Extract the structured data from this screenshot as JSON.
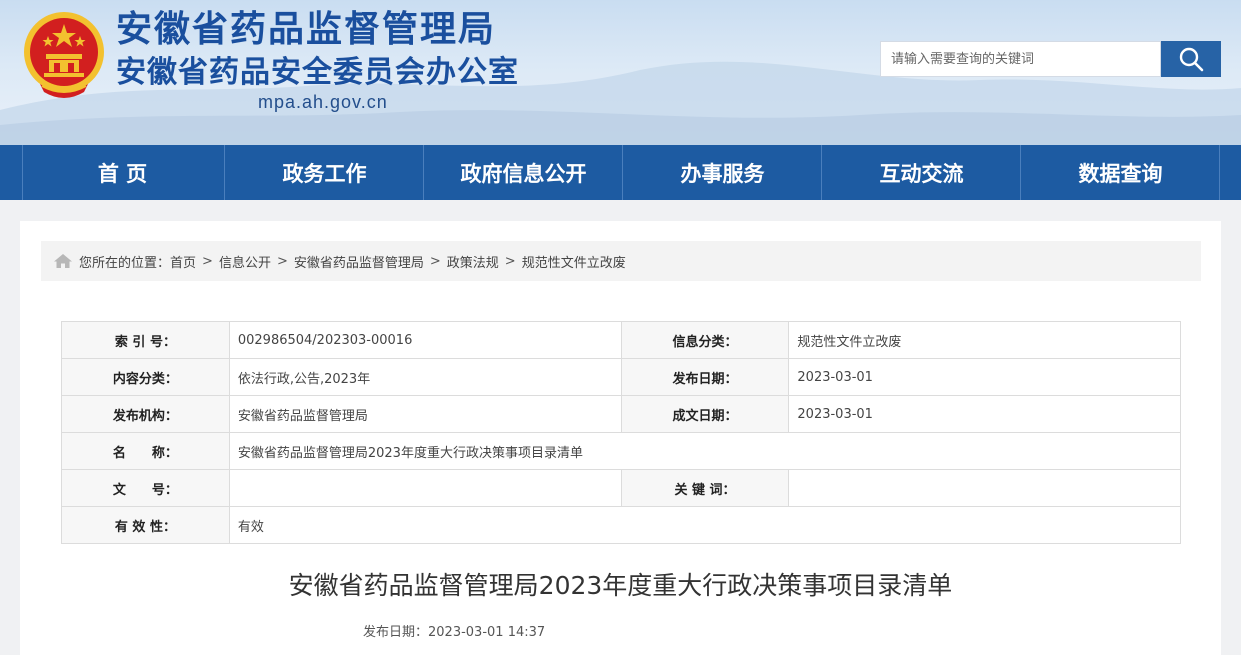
{
  "header": {
    "title": "安徽省药品监督管理局",
    "subtitle": "安徽省药品安全委员会办公室",
    "domain": "mpa.ah.gov.cn",
    "search_placeholder": "请输入需要查询的关键词",
    "emblem_icon": "national-emblem-icon",
    "search_icon": "magnifier-icon"
  },
  "nav": {
    "items": [
      {
        "label": "首 页"
      },
      {
        "label": "政务工作"
      },
      {
        "label": "政府信息公开"
      },
      {
        "label": "办事服务"
      },
      {
        "label": "互动交流"
      },
      {
        "label": "数据查询"
      }
    ]
  },
  "breadcrumb": {
    "prefix": "您所在的位置：",
    "items": [
      "首页",
      "信息公开",
      "安徽省药品监督管理局",
      "政策法规",
      "规范性文件立改废"
    ],
    "separator": ">"
  },
  "meta": {
    "index_label": "索 引 号：",
    "index_value": "002986504/202303-00016",
    "info_cat_label": "信息分类：",
    "info_cat_value": "规范性文件立改废",
    "content_cat_label": "内容分类：",
    "content_cat_value": "依法行政,公告,2023年",
    "pub_date_label": "发布日期：",
    "pub_date_value": "2023-03-01",
    "org_label": "发布机构：",
    "org_value": "安徽省药品监督管理局",
    "made_date_label": "成文日期：",
    "made_date_value": "2023-03-01",
    "name_label": "名　　称：",
    "name_value": "安徽省药品监督管理局2023年度重大行政决策事项目录清单",
    "doc_no_label": "文　　号：",
    "doc_no_value": "",
    "keyword_label": "关 键 词：",
    "keyword_value": "",
    "validity_label": "有 效 性：",
    "validity_value": "有效"
  },
  "article": {
    "title": "安徽省药品监督管理局2023年度重大行政决策事项目录清单",
    "date_label": "发布日期：",
    "date_value": "2023-03-01 14:37"
  },
  "colors": {
    "nav_bg": "#1d5ba2",
    "title_blue": "#1a4f9e",
    "search_btn": "#2763a6",
    "emblem_red": "#d21f1f",
    "emblem_gold": "#f3c12f"
  }
}
